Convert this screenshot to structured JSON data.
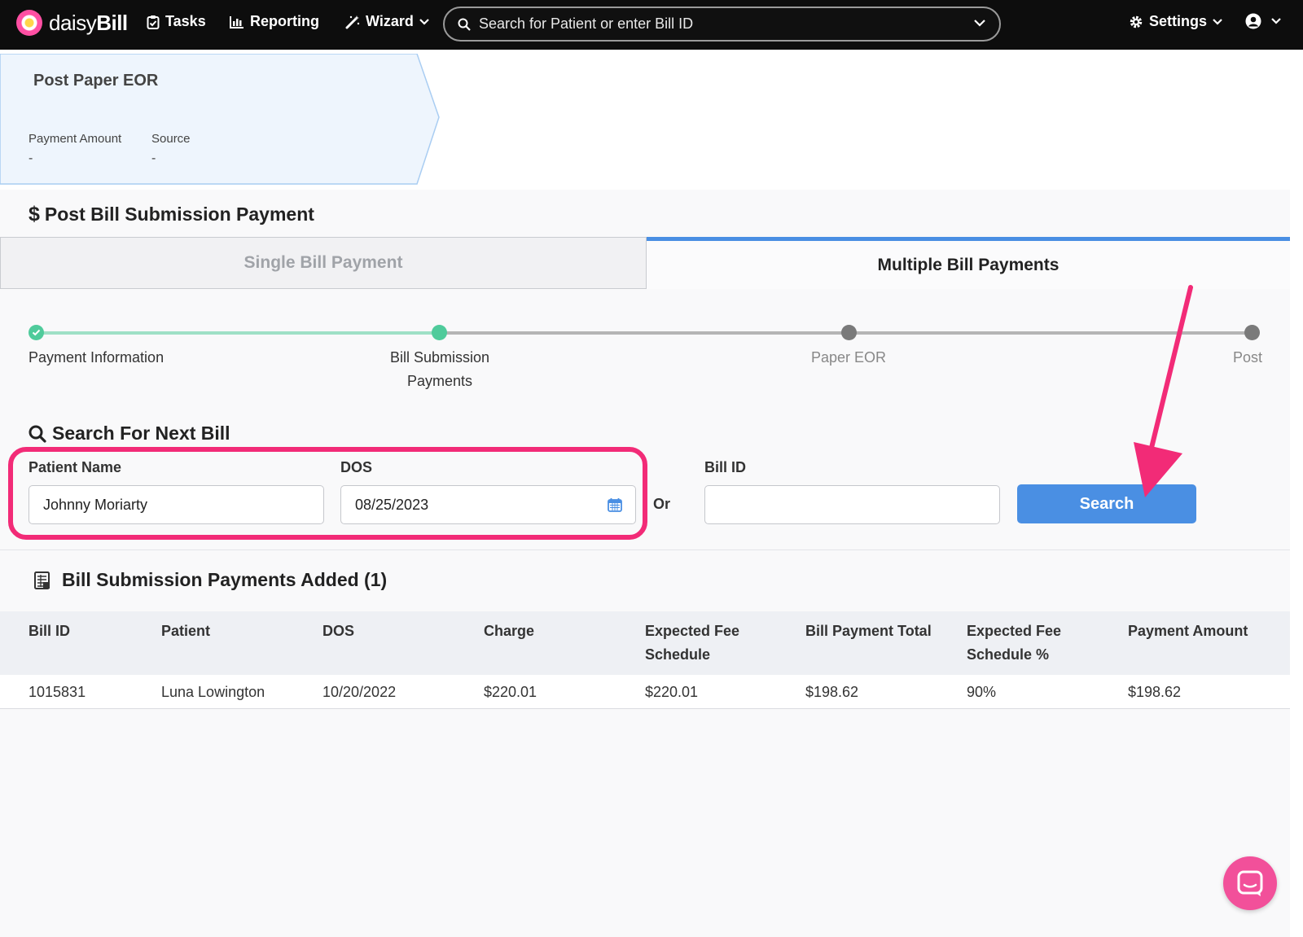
{
  "nav": {
    "brand_prefix": "daisy",
    "brand_suffix": "Bill",
    "tasks": "Tasks",
    "reporting": "Reporting",
    "wizard": "Wizard",
    "search_placeholder": "Search for Patient or enter Bill ID",
    "settings": "Settings"
  },
  "step_card": {
    "title": "Post Paper EOR",
    "payment_amount_label": "Payment Amount",
    "payment_amount_value": "-",
    "source_label": "Source",
    "source_value": "-"
  },
  "panel": {
    "title": "Post Bill Submission Payment",
    "title_symbol": "$",
    "tabs": [
      {
        "label": "Single Bill Payment",
        "active": false
      },
      {
        "label": "Multiple Bill Payments",
        "active": true
      }
    ]
  },
  "stepper": {
    "steps": [
      {
        "label": "Payment Information",
        "status": "complete"
      },
      {
        "label": "Bill Submission Payments",
        "status": "current"
      },
      {
        "label": "Paper EOR",
        "status": "pending"
      },
      {
        "label": "Post",
        "status": "pending"
      }
    ]
  },
  "search": {
    "heading": "Search For Next Bill",
    "patient_name_label": "Patient Name",
    "patient_name_value": "Johnny Moriarty",
    "dos_label": "DOS",
    "dos_value": "08/25/2023",
    "or_label": "Or",
    "bill_id_label": "Bill ID",
    "bill_id_value": "",
    "search_button": "Search"
  },
  "added": {
    "heading": "Bill Submission Payments Added (1)",
    "columns": [
      "Bill ID",
      "Patient",
      "DOS",
      "Charge",
      "Expected Fee Schedule",
      "Bill Payment Total",
      "Expected Fee Schedule %",
      "Payment Amount"
    ],
    "rows": [
      [
        "1015831",
        "Luna Lowington",
        "10/20/2022",
        "$220.01",
        "$220.01",
        "$198.62",
        "90%",
        "$198.62"
      ]
    ]
  },
  "colors": {
    "accent_blue": "#4a8fe3",
    "highlight_pink": "#f22b77",
    "step_complete": "#4fcb9b",
    "step_pending": "#7a7a7a"
  }
}
